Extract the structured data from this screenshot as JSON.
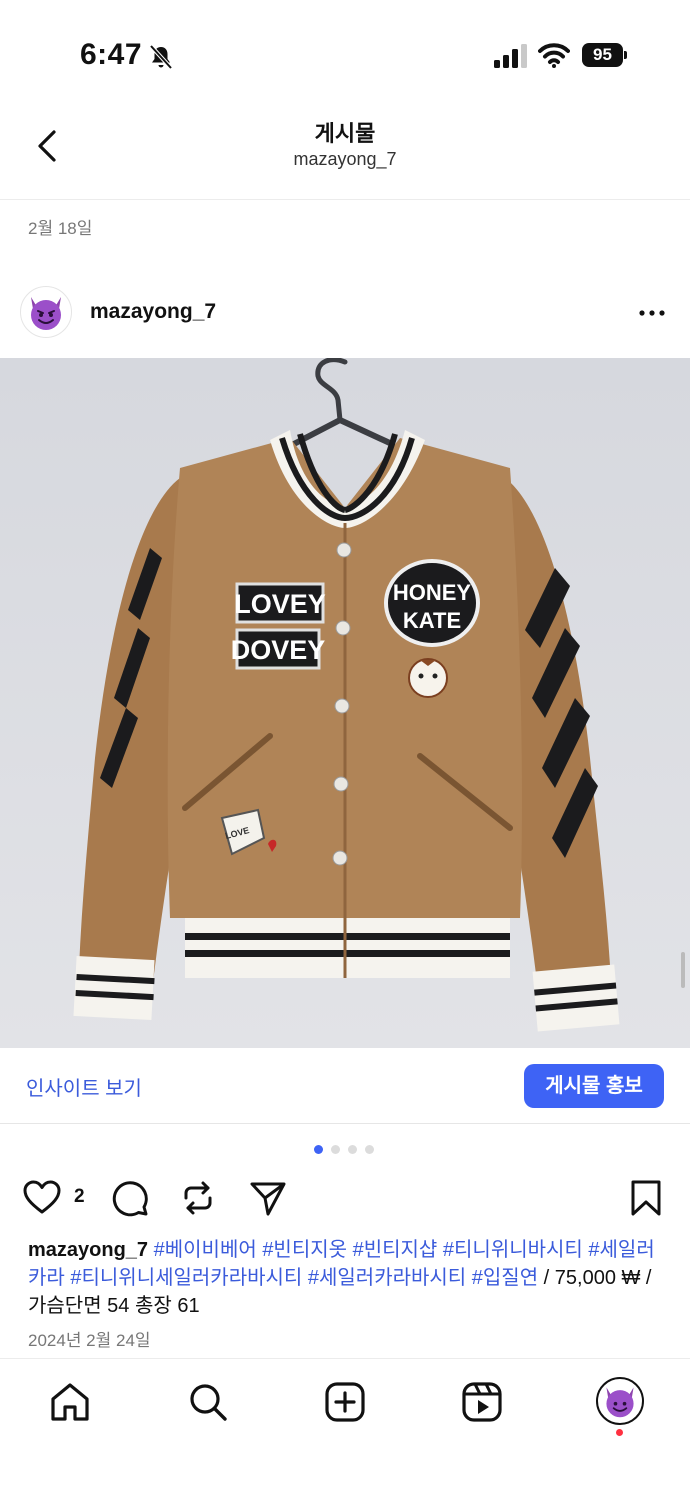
{
  "status_bar": {
    "time": "6:47",
    "battery": "95"
  },
  "header": {
    "title": "게시물",
    "subtitle": "mazayong_7"
  },
  "post": {
    "date_label": "2월 18일",
    "username": "mazayong_7",
    "image_alt": "Vintage camel wool varsity jacket with patches",
    "patches": {
      "lovey": "LOVEY",
      "dovey": "DOVEY",
      "honey": "HONEY",
      "kate": "KATE",
      "love": "LOVE"
    }
  },
  "insights": {
    "link_label": "인사이트 보기",
    "promote_label": "게시물 홍보"
  },
  "carousel": {
    "count": 4,
    "active_index": 0
  },
  "actions": {
    "like_count": "2"
  },
  "caption": {
    "username": "mazayong_7",
    "hashtags": [
      "#베이비베어",
      "#빈티지옷",
      "#빈티지샵",
      "#티니위니바시티",
      "#세일러카라",
      "#티니위니세일러카라바시티",
      "#세일러카라바시티",
      "#입질연"
    ],
    "price_text": "75,000 ₩ / 가슴단면 54 총장 61",
    "date": "2024년 2월 24일"
  },
  "icons": {
    "back": "chevron-left-icon",
    "more": "more-horizontal-icon",
    "like": "heart-icon",
    "comment": "comment-icon",
    "repost": "repost-icon",
    "share": "send-icon",
    "save": "bookmark-icon",
    "home": "home-icon",
    "search": "search-icon",
    "create": "create-icon",
    "reels": "reels-icon",
    "profile": "profile-icon"
  },
  "colors": {
    "accent": "#3e63f5",
    "link": "#3b5bdb",
    "jacket": "#b08457",
    "notification": "#ff3040"
  }
}
